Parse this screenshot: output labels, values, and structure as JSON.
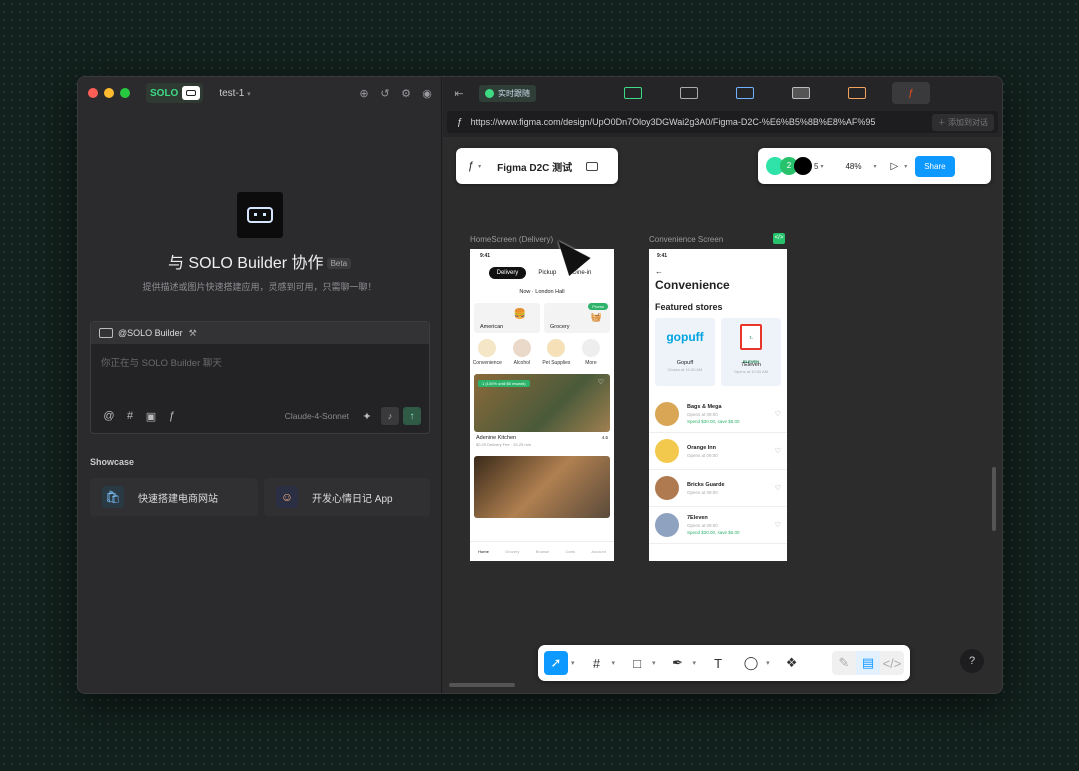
{
  "window": {
    "project": "test-1",
    "solo_label": "SOLO"
  },
  "hero": {
    "title": "与 SOLO Builder 协作",
    "beta": "Beta",
    "subtitle": "提供描述或图片快速搭建应用，灵感到可用，只需聊一聊！"
  },
  "chat": {
    "agent": "@SOLO Builder",
    "placeholder": "你正在与 SOLO Builder 聊天",
    "model": "Claude-4-Sonnet"
  },
  "showcase": {
    "title": "Showcase",
    "items": [
      {
        "label": "快速搭建电商网站"
      },
      {
        "label": "开发心情日记 App"
      }
    ]
  },
  "browser": {
    "live_label": "实时跟随",
    "url": "https://www.figma.com/design/UpO0Dn7Oloy3DGWai2g3A0/Figma-D2C-%E6%B5%8B%E8%AF%95",
    "add_label": "添加到对话"
  },
  "figma": {
    "file_name": "Figma D2C 测试",
    "avatar_count": "2",
    "members": "5",
    "zoom": "48%",
    "share": "Share",
    "frame1_label": "HomeScreen (Delivery)",
    "frame2_label": "Convenience Screen",
    "help": "?"
  },
  "home": {
    "time": "9:41",
    "tabs": [
      "Delivery",
      "Pickup",
      "Dine-in"
    ],
    "location": "Now · London Hall",
    "big": [
      {
        "label": "American"
      },
      {
        "label": "Grocery",
        "badge": "Promo"
      }
    ],
    "cats": [
      "Convenience",
      "Alcohol",
      "Pet Supplies",
      "More"
    ],
    "promo": "1 (100% until $5 reward)",
    "rest1": {
      "name": "Adenine Kitchen",
      "meta": "$0.29 Delivery Fee · 15-25 min",
      "rating": "4.6"
    },
    "nav": [
      "Home",
      "Grocery",
      "Browse",
      "Carts",
      "Account"
    ]
  },
  "conv": {
    "time": "9:41",
    "title": "Convenience",
    "subtitle": "Featured stores",
    "cards": [
      {
        "logo": "gopuff",
        "name": "Gopuff",
        "sub": "Closes at 10:30 AM"
      },
      {
        "logo": "7-ELEVEN",
        "name": "7Eleven",
        "sub": "Opens at 10:00 AM"
      }
    ],
    "stores": [
      {
        "name": "Bags & Mega",
        "sub": "Opens at 09:00",
        "promo": "Spend $30.00, save $5.00"
      },
      {
        "name": "Orange Inn",
        "sub": "Opens at 09:00",
        "promo": ""
      },
      {
        "name": "Bricks Guarde",
        "sub": "Opens at 09:00",
        "promo": ""
      },
      {
        "name": "7Eleven",
        "sub": "Opens at 09:00",
        "promo": "Spend $30.00, save $5.00"
      }
    ]
  },
  "colors": {
    "accent": "#3ddc84",
    "figma_blue": "#0d99ff"
  }
}
